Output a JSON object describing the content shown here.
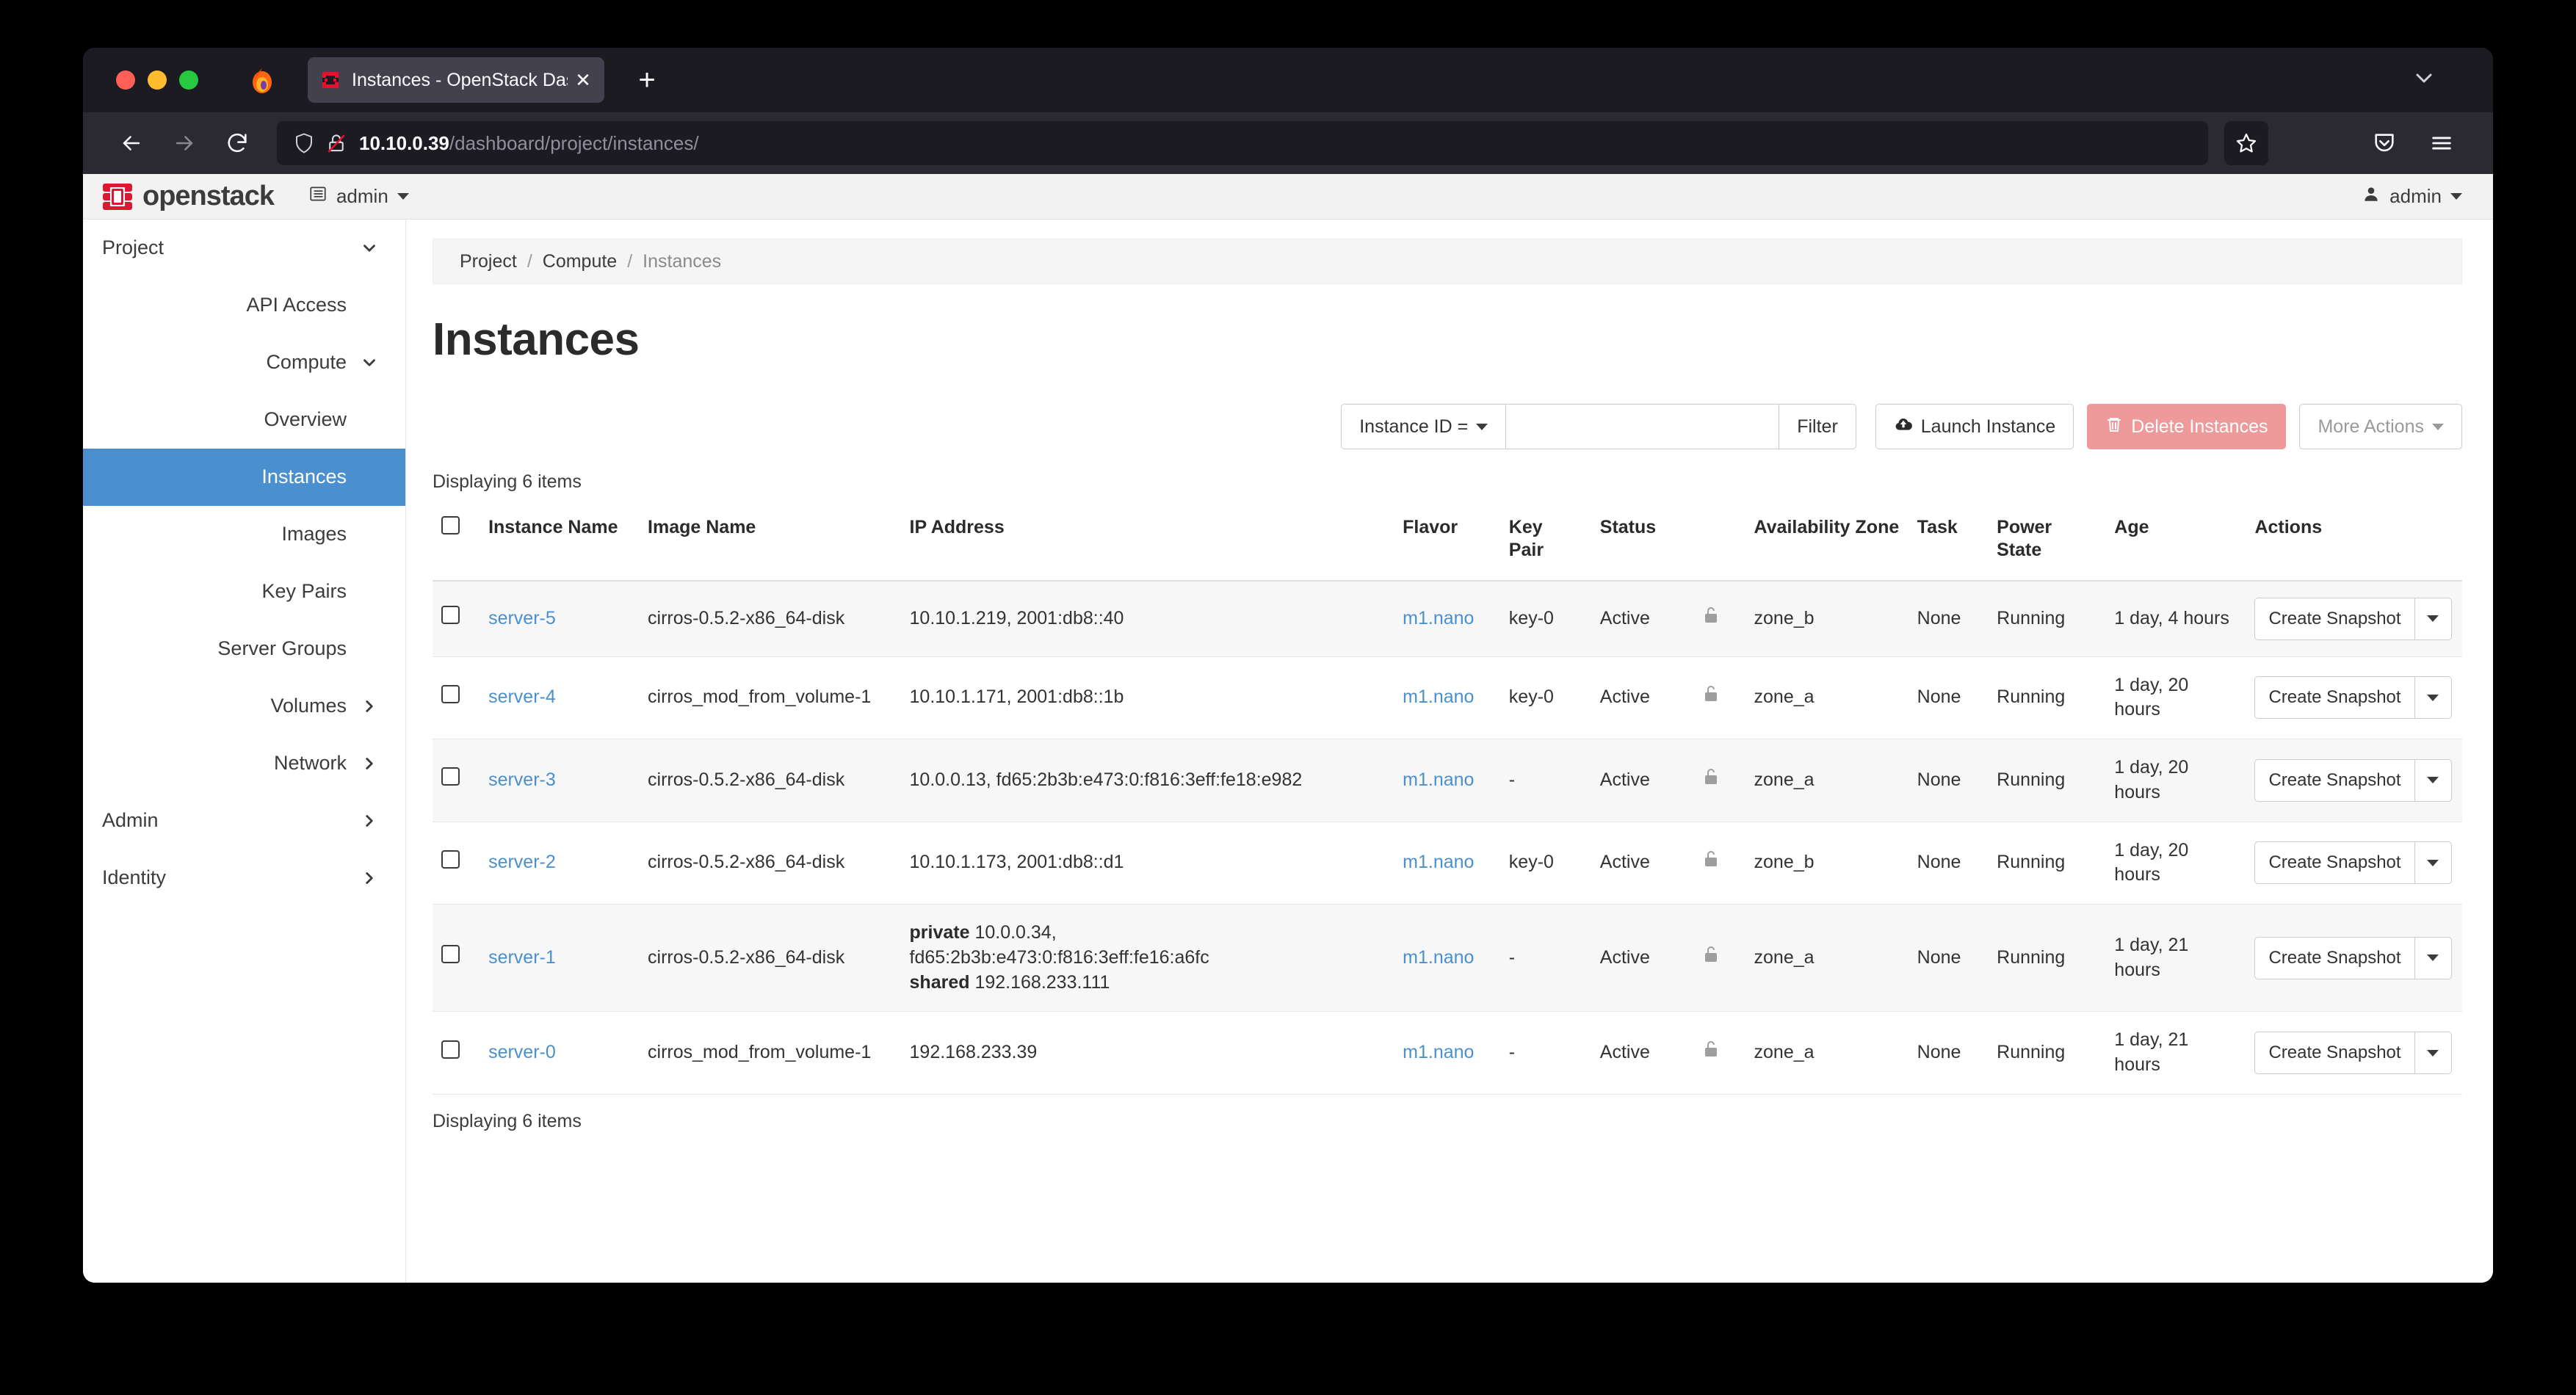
{
  "browser": {
    "tab": {
      "title": "Instances - OpenStack Dashboa",
      "close_label": "✕"
    },
    "new_tab_label": "+",
    "url": {
      "host": "10.10.0.39",
      "path": "/dashboard/project/instances/"
    },
    "icons": {
      "back": "back-arrow-icon",
      "forward": "forward-arrow-icon",
      "reload": "reload-icon",
      "shield": "shield-icon",
      "lock_insecure": "lock-crossed-icon",
      "bookmark": "star-icon",
      "pocket": "pocket-icon",
      "menu": "hamburger-menu-icon",
      "tab_list": "tab-list-chevron-icon",
      "firefox": "firefox-logo-icon",
      "favicon": "openstack-favicon-icon"
    }
  },
  "navbar": {
    "brand": "openstack",
    "brand_mark": "openstack-logo-icon",
    "project_label": "admin",
    "user_label": "admin"
  },
  "sidebar": {
    "items": [
      {
        "label": "Project",
        "level": 0,
        "chevron": "down",
        "active": false
      },
      {
        "label": "API Access",
        "level": 2,
        "chevron": "none",
        "active": false
      },
      {
        "label": "Compute",
        "level": 1,
        "chevron": "down",
        "active": false
      },
      {
        "label": "Overview",
        "level": 2,
        "chevron": "none",
        "active": false
      },
      {
        "label": "Instances",
        "level": 2,
        "chevron": "none",
        "active": true
      },
      {
        "label": "Images",
        "level": 2,
        "chevron": "none",
        "active": false
      },
      {
        "label": "Key Pairs",
        "level": 2,
        "chevron": "none",
        "active": false
      },
      {
        "label": "Server Groups",
        "level": 2,
        "chevron": "none",
        "active": false
      },
      {
        "label": "Volumes",
        "level": 1,
        "chevron": "right",
        "active": false
      },
      {
        "label": "Network",
        "level": 1,
        "chevron": "right",
        "active": false
      },
      {
        "label": "Admin",
        "level": 0,
        "chevron": "right",
        "active": false
      },
      {
        "label": "Identity",
        "level": 0,
        "chevron": "right",
        "active": false
      }
    ]
  },
  "breadcrumb": {
    "items": [
      "Project",
      "Compute",
      "Instances"
    ],
    "separator": "/"
  },
  "page_title": "Instances",
  "toolbar": {
    "filter_select": "Instance ID =",
    "filter_value": "",
    "filter_placeholder": "",
    "filter_button": "Filter",
    "launch_button": "Launch Instance",
    "launch_icon": "upload-cloud-icon",
    "delete_button": "Delete Instances",
    "delete_icon": "trash-icon",
    "more_actions": "More Actions"
  },
  "count_top": "Displaying 6 items",
  "count_bottom": "Displaying 6 items",
  "table": {
    "columns": [
      "Instance Name",
      "Image Name",
      "IP Address",
      "Flavor",
      "Key Pair",
      "Status",
      "Availability Zone",
      "Task",
      "Power State",
      "Age",
      "Actions"
    ],
    "action_label": "Create Snapshot",
    "lock_icon": "unlocked-padlock-icon",
    "rows": [
      {
        "name": "server-5",
        "image": "cirros-0.5.2-x86_64-disk",
        "ip_lines": [
          {
            "label": "",
            "value": "10.10.1.219, 2001:db8::40"
          }
        ],
        "flavor": "m1.nano",
        "key_pair": "key-0",
        "status": "Active",
        "availability_zone": "zone_b",
        "task": "None",
        "power_state": "Running",
        "age": "1 day, 4 hours"
      },
      {
        "name": "server-4",
        "image": "cirros_mod_from_volume-1",
        "ip_lines": [
          {
            "label": "",
            "value": "10.10.1.171, 2001:db8::1b"
          }
        ],
        "flavor": "m1.nano",
        "key_pair": "key-0",
        "status": "Active",
        "availability_zone": "zone_a",
        "task": "None",
        "power_state": "Running",
        "age": "1 day, 20 hours"
      },
      {
        "name": "server-3",
        "image": "cirros-0.5.2-x86_64-disk",
        "ip_lines": [
          {
            "label": "",
            "value": "10.0.0.13, fd65:2b3b:e473:0:f816:3eff:fe18:e982"
          }
        ],
        "flavor": "m1.nano",
        "key_pair": "-",
        "status": "Active",
        "availability_zone": "zone_a",
        "task": "None",
        "power_state": "Running",
        "age": "1 day, 20 hours"
      },
      {
        "name": "server-2",
        "image": "cirros-0.5.2-x86_64-disk",
        "ip_lines": [
          {
            "label": "",
            "value": "10.10.1.173, 2001:db8::d1"
          }
        ],
        "flavor": "m1.nano",
        "key_pair": "key-0",
        "status": "Active",
        "availability_zone": "zone_b",
        "task": "None",
        "power_state": "Running",
        "age": "1 day, 20 hours"
      },
      {
        "name": "server-1",
        "image": "cirros-0.5.2-x86_64-disk",
        "ip_lines": [
          {
            "label": "private",
            "value": "10.0.0.34,"
          },
          {
            "label": "",
            "value": "fd65:2b3b:e473:0:f816:3eff:fe16:a6fc"
          },
          {
            "label": "shared",
            "value": "192.168.233.111"
          }
        ],
        "flavor": "m1.nano",
        "key_pair": "-",
        "status": "Active",
        "availability_zone": "zone_a",
        "task": "None",
        "power_state": "Running",
        "age": "1 day, 21 hours"
      },
      {
        "name": "server-0",
        "image": "cirros_mod_from_volume-1",
        "ip_lines": [
          {
            "label": "",
            "value": "192.168.233.39"
          }
        ],
        "flavor": "m1.nano",
        "key_pair": "-",
        "status": "Active",
        "availability_zone": "zone_a",
        "task": "None",
        "power_state": "Running",
        "age": "1 day, 21 hours"
      }
    ]
  },
  "colors": {
    "accent_blue": "#4a90cf",
    "brand_red": "#da1a32",
    "delete_salmon": "#ef9a9a",
    "chrome_dark": "#2b2a33",
    "chrome_darker": "#1c1b22"
  }
}
